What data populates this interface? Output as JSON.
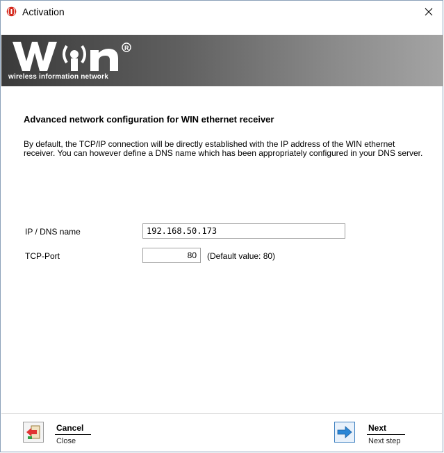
{
  "window": {
    "title": "Activation",
    "close_glyph": "✕"
  },
  "banner": {
    "logo_text": "W(•)n",
    "registered": "®",
    "subtitle": "wireless information network"
  },
  "content": {
    "heading": "Advanced network configuration for WIN ethernet receiver",
    "description": "By default, the TCP/IP connection will be directly established with the IP address of the WIN ethernet receiver. You can however define a DNS name which has been appropriately configured in your DNS server."
  },
  "fields": {
    "ip_label": "IP / DNS name",
    "ip_value": "192.168.50.173",
    "port_label": "TCP-Port",
    "port_value": "80",
    "port_hint": "(Default value: 80)"
  },
  "footer": {
    "cancel_label": "Cancel",
    "cancel_sub": "Close",
    "next_label": "Next",
    "next_sub": "Next step"
  },
  "colors": {
    "accent": "#3c7fc0",
    "app_icon": "#d4281c"
  }
}
